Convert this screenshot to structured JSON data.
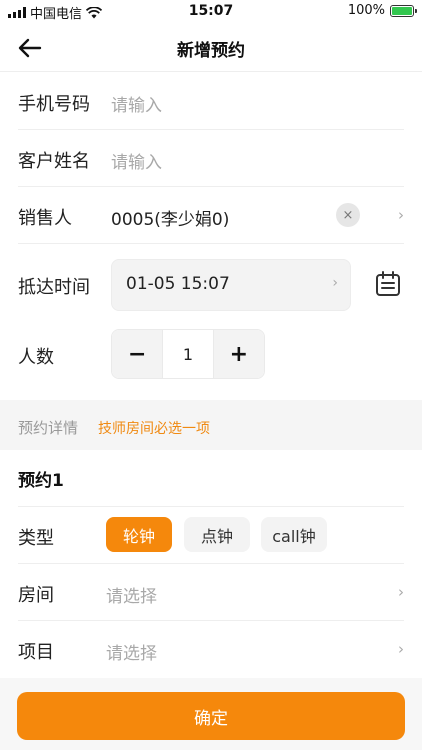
{
  "status": {
    "carrier": "中国电信",
    "time": "15:07",
    "battery": "100%",
    "battery_level": 1.0
  },
  "nav": {
    "title": "新增预约"
  },
  "form": {
    "phone": {
      "label": "手机号码",
      "placeholder": "请输入"
    },
    "name": {
      "label": "客户姓名",
      "placeholder": "请输入"
    },
    "sales": {
      "label": "销售人",
      "value": "0005(李少娟0)",
      "clear_icon": "×"
    },
    "arrival": {
      "label": "抵达时间",
      "value": "01-05 15:07"
    },
    "people": {
      "label": "人数",
      "count": "1",
      "minus": "−",
      "plus": "+"
    }
  },
  "details": {
    "title": "预约详情",
    "hint": "技师房间必选一项"
  },
  "booking": {
    "title": "预约1",
    "type_label": "类型",
    "types": [
      "轮钟",
      "点钟",
      "call钟"
    ],
    "selected_type": "轮钟",
    "room": {
      "label": "房间",
      "placeholder": "请选择"
    },
    "project": {
      "label": "项目",
      "placeholder": "请选择"
    }
  },
  "footer": {
    "confirm": "确定"
  },
  "icons": {
    "chevron": "›",
    "back": "arrow-left-icon",
    "calendar": "calendar-icon",
    "wifi": "wifi-icon",
    "signal": "signal-icon",
    "battery": "battery-charging-icon"
  },
  "colors": {
    "accent": "#f5880c",
    "hint": "#f08a12",
    "placeholder": "#a8a8a8"
  }
}
